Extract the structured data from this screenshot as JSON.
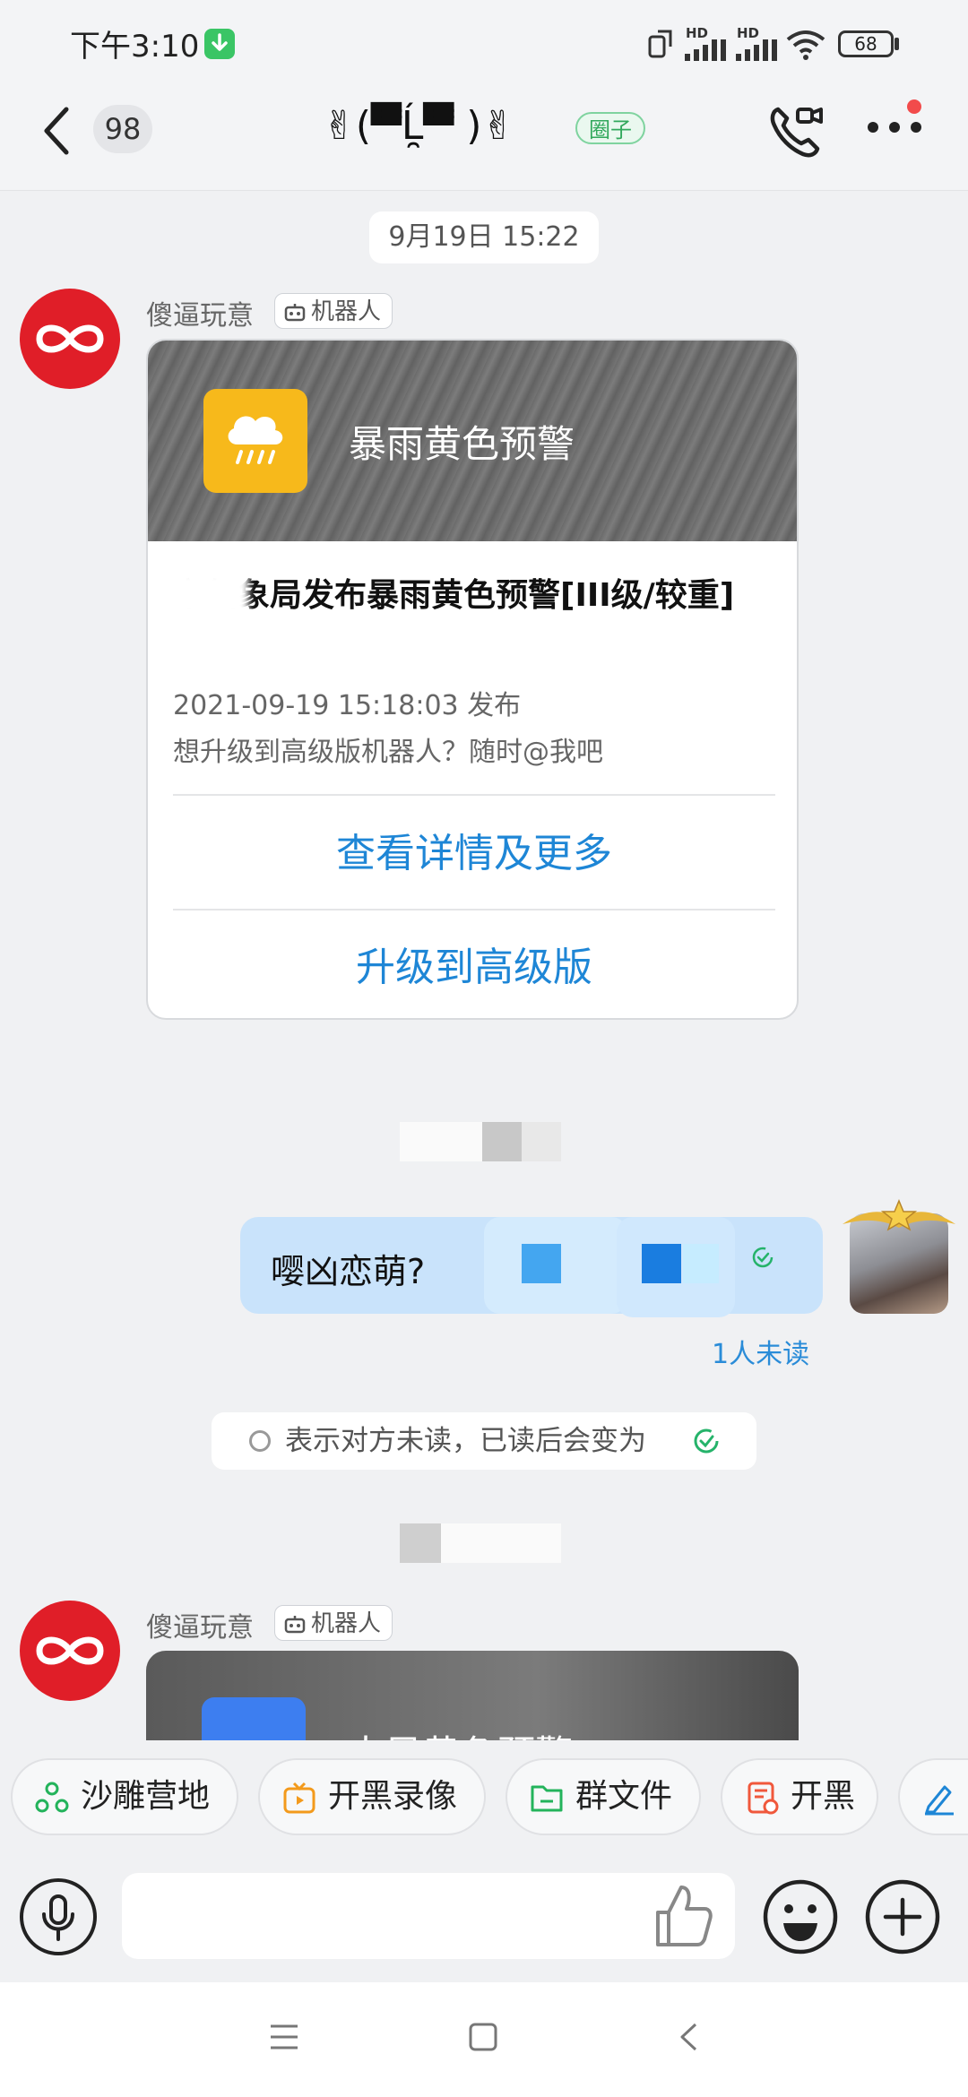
{
  "status_bar": {
    "time": "下午3:10",
    "signal_1_label": "HD",
    "signal_2_label": "HD",
    "battery": "68"
  },
  "header": {
    "unread_count": "98",
    "title": "✌(▀̿Ĺ̯▀̿ )✌",
    "tag": "圈子"
  },
  "messages": {
    "timestamp_1": "9月19日 15:22",
    "bot_name": "傻逼玩意",
    "bot_tag": "机器人",
    "card": {
      "banner_title": "暴雨黄色预警",
      "headline": "市气象局发布暴雨黄色预警[III级/较重]",
      "time": "2021-09-19 15:18:03 发布",
      "hint": "想升级到高级版机器人？随时@我吧",
      "link_details": "查看详情及更多",
      "link_upgrade": "升级到高级版"
    },
    "my_message": "嘤凶恋萌?",
    "unread_status": "1人未读",
    "read_tip": "表示对方未读，已读后会变为",
    "bot_name_2": "傻逼玩意",
    "bot_tag_2": "机器人",
    "card2_title": "大风黄色预警"
  },
  "quick_actions": [
    {
      "label": "沙雕营地",
      "icon": "camp-icon",
      "color": "#23b35b"
    },
    {
      "label": "开黑录像",
      "icon": "video-record-icon",
      "color": "#f39a1c"
    },
    {
      "label": "群文件",
      "icon": "folder-icon",
      "color": "#23b35b"
    },
    {
      "label": "开黑",
      "icon": "game-icon",
      "color": "#f0583c"
    },
    {
      "label": "",
      "icon": "pencil-icon",
      "color": "#1e86d6"
    }
  ],
  "input": {
    "placeholder": ""
  },
  "colors": {
    "accent_blue": "#1e86d6",
    "bot_red": "#e01e28",
    "warning_yellow": "#f7b91b",
    "bubble_blue": "#c9e3fb"
  }
}
